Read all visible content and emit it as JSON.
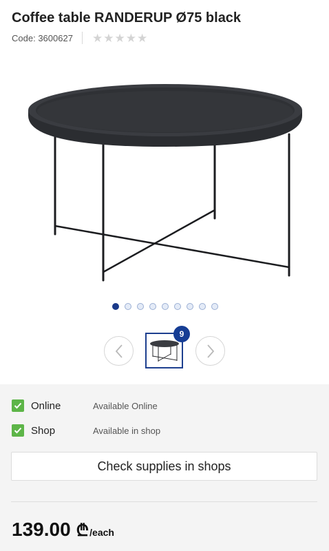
{
  "product": {
    "title": "Coffee table RANDERUP Ø75 black",
    "code_label": "Code:",
    "code_value": "3600627",
    "rating": 0,
    "rating_max": 5,
    "image_icon": "coffee-table-image"
  },
  "gallery": {
    "image_count": 9,
    "active_index": 0,
    "thumb_badge": "9",
    "prev_icon": "chevron-left-icon",
    "next_icon": "chevron-right-icon"
  },
  "availability": [
    {
      "label": "Online",
      "status": "Available Online",
      "checked": true
    },
    {
      "label": "Shop",
      "status": "Available in shop",
      "checked": true
    }
  ],
  "check_supplies_label": "Check supplies in shops",
  "price": {
    "amount": "139.00",
    "currency": "₾",
    "unit": "/each"
  },
  "colors": {
    "accent": "#1b3a8a",
    "check": "#5db548",
    "panel_bg": "#f4f4f4"
  }
}
